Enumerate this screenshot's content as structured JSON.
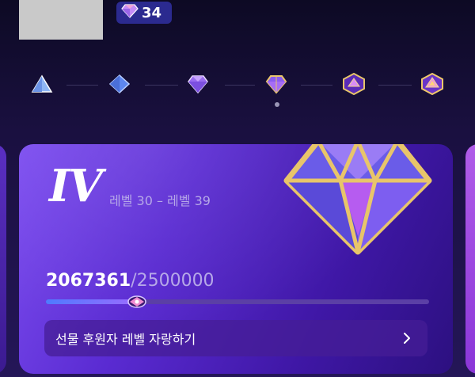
{
  "header": {
    "gem_count": "34",
    "gem_icon": "diamond-icon"
  },
  "tiers": [
    {
      "name": "tier-1",
      "icon": "triangle-gem-icon"
    },
    {
      "name": "tier-2",
      "icon": "diamond-gem-icon"
    },
    {
      "name": "tier-3",
      "icon": "purple-gem-icon"
    },
    {
      "name": "tier-4",
      "icon": "gold-gem-icon"
    },
    {
      "name": "tier-5",
      "icon": "hexagon-gem-icon"
    },
    {
      "name": "tier-6",
      "icon": "hexagon-gold-gem-icon"
    }
  ],
  "card": {
    "tier_roman": "IV",
    "level_range": "레벨 30 – 레벨 39",
    "progress_current": "2067361",
    "progress_separator": "/",
    "progress_total": "2500000",
    "progress_fraction": 0.2367,
    "brag_label": "선물 후원자 레벨 자랑하기",
    "brag_icon": "chevron-right-icon"
  },
  "colors": {
    "background": "#1a1040",
    "card": "#5a2bd2",
    "gem_gold": "#e8c56a",
    "gem_purple": "#8a5cf0",
    "badge": "#2b2a8f"
  }
}
